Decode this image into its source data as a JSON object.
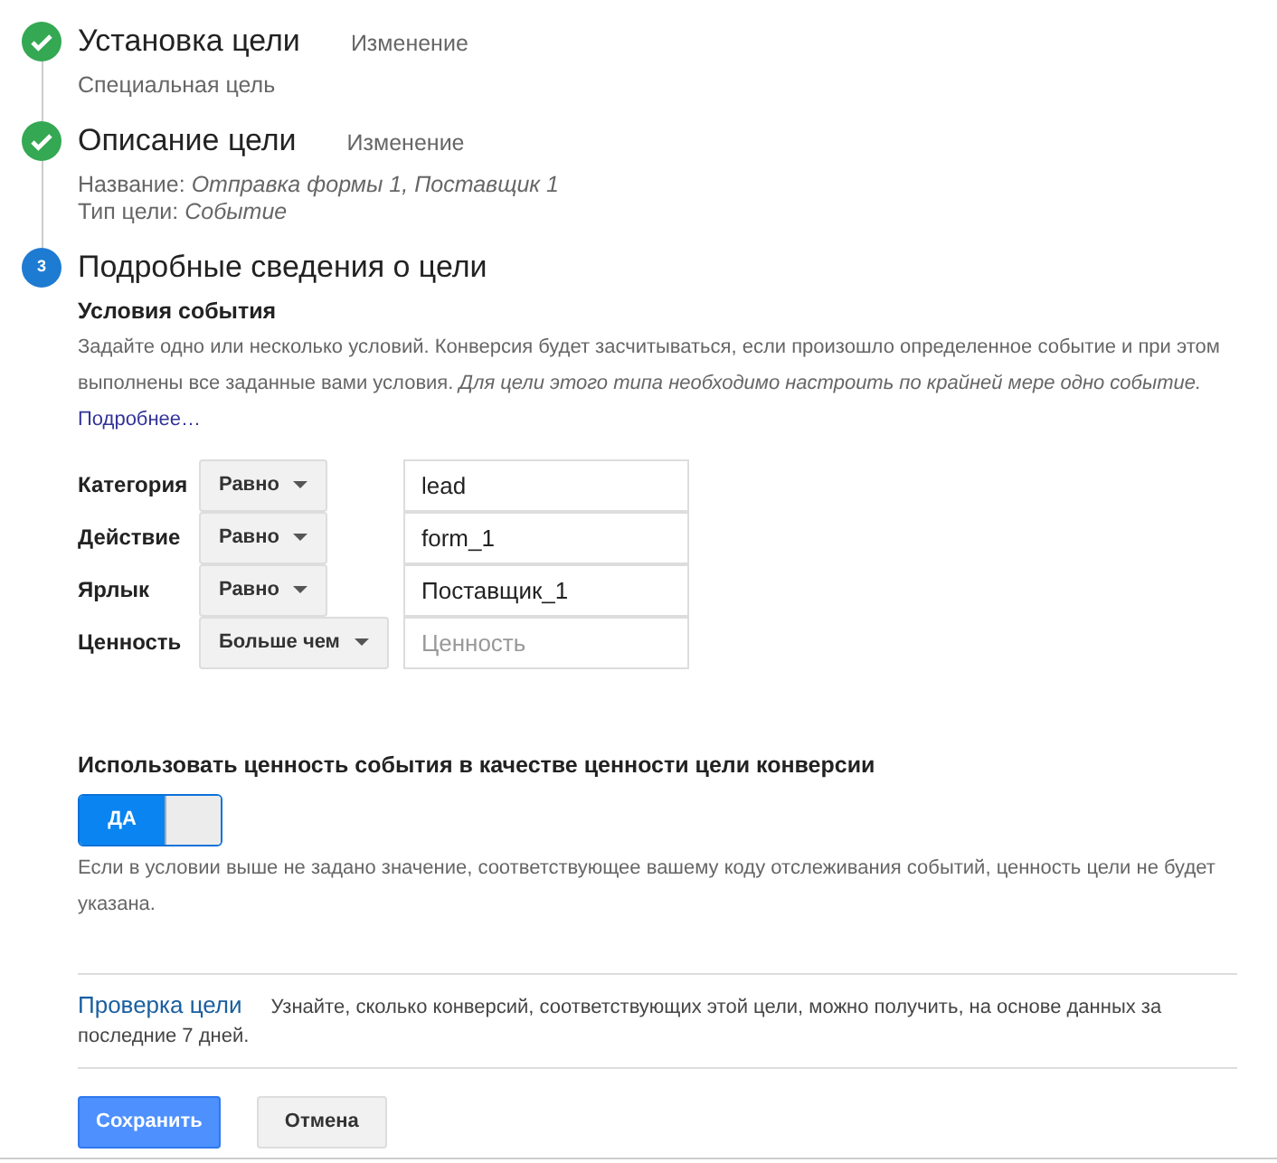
{
  "steps": [
    {
      "done": true,
      "title": "Установка цели",
      "edit_link": "Изменение",
      "details": [
        "Специальная цель"
      ]
    },
    {
      "done": true,
      "title": "Описание цели",
      "edit_link": "Изменение",
      "details": [
        "Название: *Отправка формы 1, Поставщик 1*",
        "Тип цели: *Событие*"
      ]
    },
    {
      "done": false,
      "number": "3",
      "title": "Подробные сведения о цели"
    }
  ],
  "event_conditions": {
    "heading": "Условия события",
    "description": "Задайте одно или несколько условий. Конверсия будет засчитываться, если произошло определенное событие и при этом выполнены все заданные вами условия. *Для цели этого типа необходимо настроить по крайней мере одно событие.*",
    "more_link": "Подробнее…",
    "rows": [
      {
        "label": "Категория",
        "operator": "Равно",
        "value": "lead"
      },
      {
        "label": "Действие",
        "operator": "Равно",
        "value": "form_1"
      },
      {
        "label": "Ярлык",
        "operator": "Равно",
        "value": "Поставщик_1"
      },
      {
        "label": "Ценность",
        "operator": "Больше чем",
        "placeholder": "Ценность"
      }
    ]
  },
  "use_value": {
    "heading": "Использовать ценность события в качестве ценности цели конверсии",
    "toggle": {
      "label": "ДА",
      "on": true
    },
    "note": "Если в условии выше не задано значение, соответствующее вашему коду отслеживания событий, ценность цели не будет указана."
  },
  "verify": {
    "link": "Проверка цели",
    "text": "Узнайте, сколько конверсий, соответствующих этой цели, можно получить, на основе данных за последние 7 дней."
  },
  "buttons": [
    {
      "label": "Сохранить",
      "kind": "primary"
    },
    {
      "label": "Отмена",
      "kind": "secondary"
    }
  ]
}
